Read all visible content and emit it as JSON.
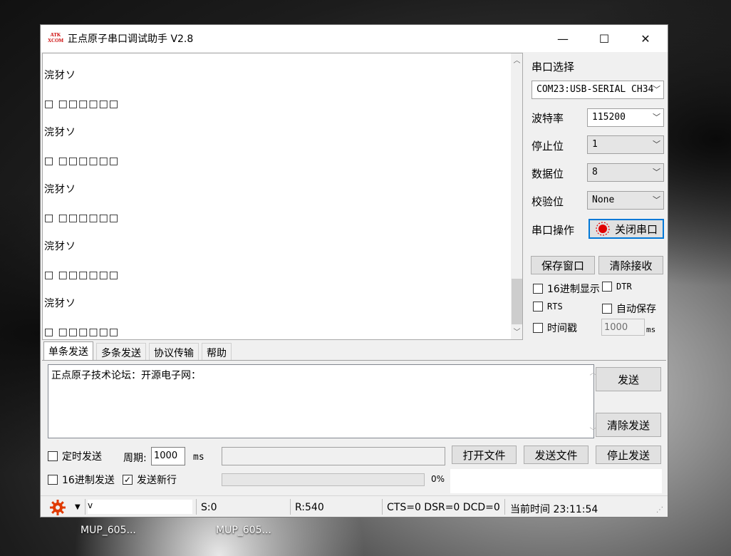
{
  "window": {
    "title": "正点原子串口调试助手 V2.8",
    "icon_lines": [
      "ATK",
      "XCOM"
    ],
    "minimize_glyph": "—",
    "maximize_glyph": "☐",
    "close_glyph": "✕"
  },
  "receive": {
    "lines": [
      "浣犲ソ",
      "□ □□□□□□",
      "浣犲ソ",
      "□ □□□□□□",
      "浣犲ソ",
      "□ □□□□□□",
      "浣犲ソ",
      "□ □□□□□□",
      "浣犲ソ",
      "□ □□□□□□"
    ],
    "scroll_up": "︿",
    "scroll_down": "﹀"
  },
  "settings": {
    "port_select_label": "串口选择",
    "port_value": "COM23:USB-SERIAL CH34",
    "baud_label": "波特率",
    "baud_value": "115200",
    "stop_label": "停止位",
    "stop_value": "1",
    "data_label": "数据位",
    "data_value": "8",
    "parity_label": "校验位",
    "parity_value": "None",
    "op_label": "串口操作",
    "op_button": "关闭串口",
    "save_window": "保存窗口",
    "clear_receive": "清除接收",
    "hex_display": "16进制显示",
    "dtr": "DTR",
    "rts": "RTS",
    "auto_save": "自动保存",
    "timestamp": "时间戳",
    "timestamp_value": "1000",
    "timestamp_unit": "ms"
  },
  "tabs": [
    "单条发送",
    "多条发送",
    "协议传输",
    "帮助"
  ],
  "send": {
    "text": "正点原子技术论坛：开源电子网：",
    "send_button": "发送",
    "clear_send_button": "清除发送",
    "timed_send": "定时发送",
    "period_label": "周期:",
    "period_value": "1000",
    "period_unit": "ms",
    "open_file": "打开文件",
    "send_file": "发送文件",
    "stop_send": "停止发送",
    "hex_send": "16进制发送",
    "send_newline": "发送新行",
    "progress_text": "0%",
    "progress": 0
  },
  "status": {
    "url": "v",
    "sent": "S:0",
    "received": "R:540",
    "lines": "CTS=0 DSR=0 DCD=0",
    "time_label": "当前时间 23:11:54"
  },
  "desktop": {
    "items": [
      "MUP_605...",
      "MUP_605..."
    ]
  },
  "colors": {
    "accent": "#0078d7",
    "gear": "#e03a00",
    "record": "#e00000"
  }
}
